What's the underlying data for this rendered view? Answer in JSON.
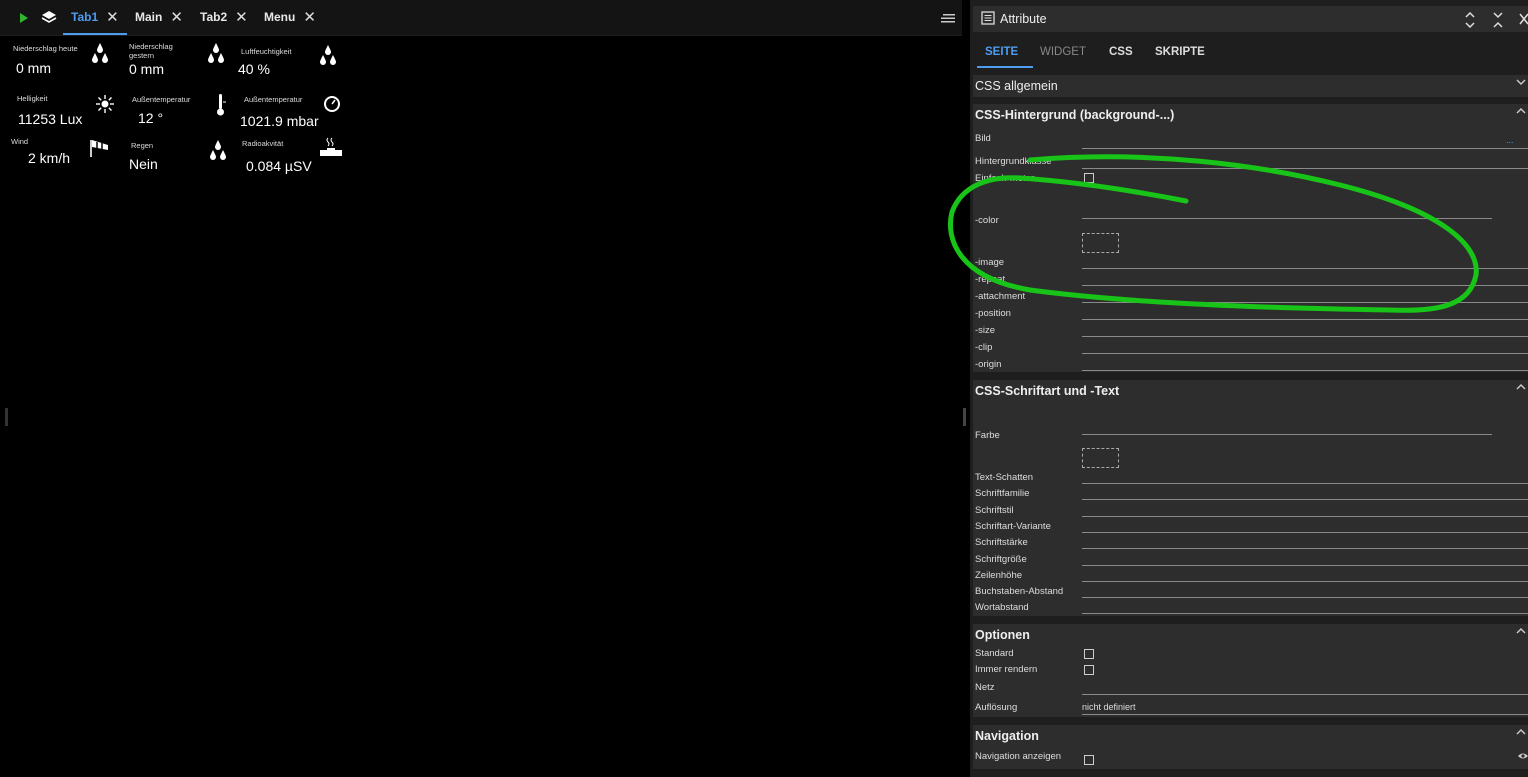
{
  "topbar": {
    "tabs": [
      {
        "label": "Tab1",
        "active": true
      },
      {
        "label": "Main",
        "active": false
      },
      {
        "label": "Tab2",
        "active": false
      },
      {
        "label": "Menu",
        "active": false
      }
    ],
    "close_glyph": "✕"
  },
  "widgets": [
    {
      "label": "Niederschlag heute",
      "value": "0 mm",
      "icon": "raindrops-icon"
    },
    {
      "label": "Niederschlag gestern",
      "value": "0 mm",
      "icon": "raindrops-icon"
    },
    {
      "label": "Luftfeuchtigkeit",
      "value": "40 %",
      "icon": "raindrops-icon"
    },
    {
      "label": "Helligkeit",
      "value": "11253 Lux",
      "icon": "sun-icon"
    },
    {
      "label": "Außentemperatur",
      "value": "12 °",
      "icon": "thermometer-icon"
    },
    {
      "label": "Außentemperatur",
      "value": "1021.9 mbar",
      "icon": "gauge-icon"
    },
    {
      "label": "Wind",
      "value": "2 km/h",
      "icon": "windsock-icon"
    },
    {
      "label": "Regen",
      "value": "Nein",
      "icon": "raindrops-icon"
    },
    {
      "label": "Radioakvität",
      "value": "0.084 µSV",
      "icon": "radiation-icon"
    }
  ],
  "panel": {
    "title": "Attribute",
    "tabs": [
      "SEITE",
      "WIDGET",
      "CSS",
      "SKRIPTE"
    ],
    "css_general": "CSS allgemein",
    "bg_section": {
      "title": "CSS-Hintergrund (background-...)",
      "rows": [
        "Bild",
        "Hintergrundklasse",
        "Einfach-meter",
        "-color",
        "-image",
        "-repeat",
        "-attachment",
        "-position",
        "-size",
        "-clip",
        "-origin"
      ],
      "bild_more": "..."
    },
    "font_section": {
      "title": "CSS-Schriftart und -Text",
      "rows": [
        "Farbe",
        "Text-Schatten",
        "Schriftfamilie",
        "Schriftstil",
        "Schriftart-Variante",
        "Schriftstärke",
        "Schriftgröße",
        "Zeilenhöhe",
        "Buchstaben-Abstand",
        "Wortabstand"
      ]
    },
    "options_section": {
      "title": "Optionen",
      "rows": [
        "Standard",
        "Immer rendern",
        "Netz",
        "Auflösung"
      ],
      "resolution_value": "nicht definiert"
    },
    "nav_section": {
      "title": "Navigation",
      "rows": [
        "Navigation anzeigen"
      ]
    }
  },
  "colors": {
    "accent": "#4c9cf0",
    "annotation": "#18c418",
    "play": "#2fb52f"
  }
}
